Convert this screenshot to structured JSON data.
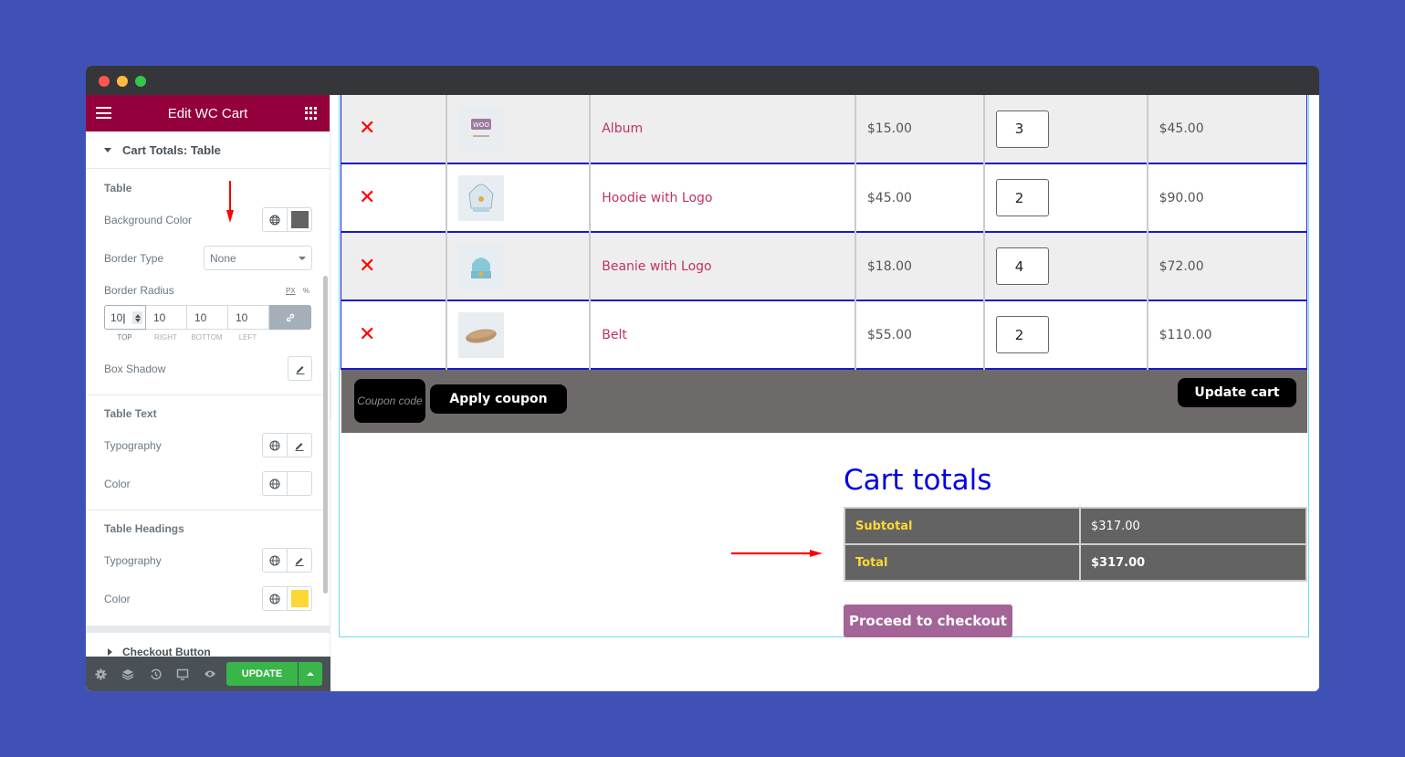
{
  "window": {
    "traffic_lights": [
      "close",
      "minimize",
      "maximize"
    ]
  },
  "panel": {
    "title": "Edit WC Cart",
    "menu_icon": "hamburger-icon",
    "apps_icon": "grid-icon",
    "section_open": "Cart Totals: Table",
    "groups": {
      "table": {
        "heading": "Table",
        "background_color_label": "Background Color",
        "background_color": "#636363",
        "border_type_label": "Border Type",
        "border_type_value": "None",
        "border_radius_label": "Border Radius",
        "units": [
          "PX",
          "%"
        ],
        "active_unit": "PX",
        "radius": {
          "top": "10",
          "right": "10",
          "bottom": "10",
          "left": "10"
        },
        "radius_labels": [
          "TOP",
          "RIGHT",
          "BOTTOM",
          "LEFT"
        ],
        "box_shadow_label": "Box Shadow"
      },
      "table_text": {
        "heading": "Table Text",
        "typography_label": "Typography",
        "color_label": "Color",
        "color": "#ffffff"
      },
      "table_headings": {
        "heading": "Table Headings",
        "typography_label": "Typography",
        "color_label": "Color",
        "color": "#fdd835"
      }
    },
    "section_collapsed": "Checkout Button",
    "footer": {
      "icons": [
        "settings-icon",
        "layers-icon",
        "history-icon",
        "responsive-icon",
        "preview-icon"
      ],
      "update_label": "UPDATE"
    }
  },
  "cart": {
    "rows": [
      {
        "name": "Album",
        "price": "$15.00",
        "qty": "3",
        "subtotal": "$45.00",
        "thumb": "album"
      },
      {
        "name": "Hoodie with Logo",
        "price": "$45.00",
        "qty": "2",
        "subtotal": "$90.00",
        "thumb": "hoodie"
      },
      {
        "name": "Beanie with Logo",
        "price": "$18.00",
        "qty": "4",
        "subtotal": "$72.00",
        "thumb": "beanie"
      },
      {
        "name": "Belt",
        "price": "$55.00",
        "qty": "2",
        "subtotal": "$110.00",
        "thumb": "belt"
      }
    ],
    "remove_glyph": "✕",
    "coupon_placeholder": "Coupon code",
    "apply_coupon_label": "Apply coupon",
    "update_cart_label": "Update cart"
  },
  "totals": {
    "title": "Cart totals",
    "subtotal_label": "Subtotal",
    "subtotal_value": "$317.00",
    "total_label": "Total",
    "total_value": "$317.00",
    "checkout_label": "Proceed to checkout"
  },
  "colors": {
    "panel_header": "#93003c",
    "update_green": "#39b54a",
    "checkout_purple": "#a46497",
    "totals_title_blue": "#0000e6",
    "annotation_red": "#ff0000"
  }
}
